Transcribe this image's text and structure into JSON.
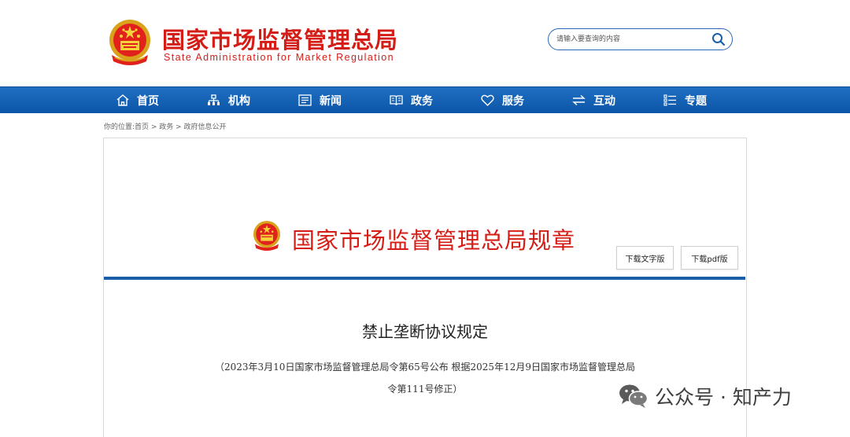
{
  "header": {
    "title": "国家市场监督管理总局",
    "subtitle": "State Administration for Market Regulation",
    "search_placeholder": "请输入要查询的内容",
    "brand_color": "#d41d16"
  },
  "nav": {
    "items": [
      {
        "label": "首页",
        "icon": "home-icon"
      },
      {
        "label": "机构",
        "icon": "org-chart-icon"
      },
      {
        "label": "新闻",
        "icon": "newspaper-icon"
      },
      {
        "label": "政务",
        "icon": "book-icon"
      },
      {
        "label": "服务",
        "icon": "heart-icon"
      },
      {
        "label": "互动",
        "icon": "exchange-arrows-icon"
      },
      {
        "label": "专题",
        "icon": "list-icon"
      }
    ],
    "background": "#1565b6"
  },
  "breadcrumb": "你的位置:首页 > 政务 > 政府信息公开",
  "panel": {
    "title": "国家市场监督管理总局规章",
    "download_text": "下载文字版",
    "download_pdf": "下载pdf版"
  },
  "document": {
    "title": "禁止垄断协议规定",
    "note_line1": "（2023年3月10日国家市场监督管理总局令第65号公布 根据2025年12月9日国家市场监督管理总局",
    "note_line2": "令第111号修正）"
  },
  "watermark": "公众号 · 知产力"
}
